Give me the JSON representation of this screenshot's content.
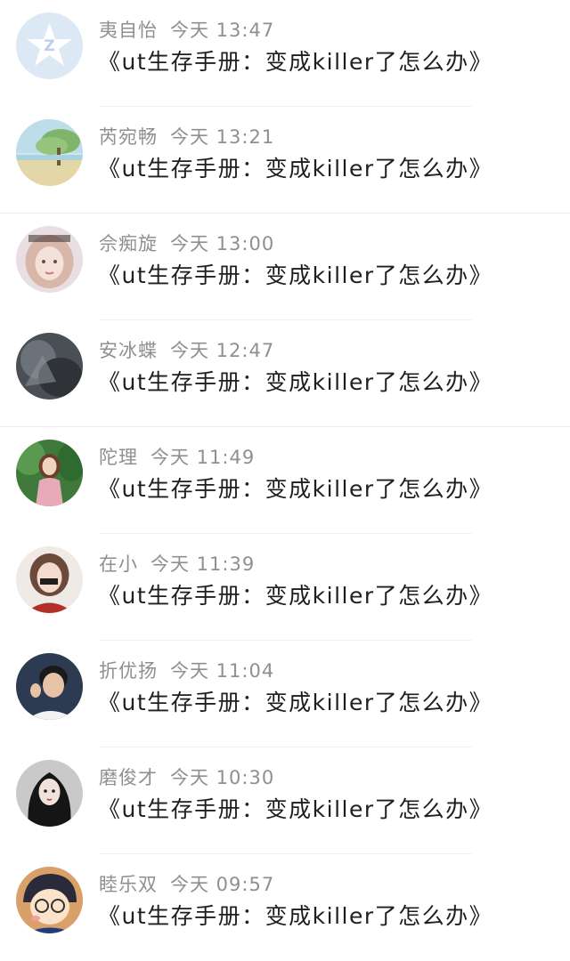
{
  "messages": [
    {
      "name": "夷自怡",
      "time": "今天 13:47",
      "text": "《ut生存手册：变成killer了怎么办》",
      "avatar_icon": "default-blue-avatar"
    },
    {
      "name": "芮宛畅",
      "time": "今天 13:21",
      "text": "《ut生存手册：变成killer了怎么办》",
      "avatar_icon": "landscape-tree-avatar"
    },
    {
      "name": "佘痴旋",
      "time": "今天 13:00",
      "text": "《ut生存手册：变成killer了怎么办》",
      "avatar_icon": "girl-portrait-avatar"
    },
    {
      "name": "安冰蝶",
      "time": "今天 12:47",
      "text": "《ut生存手册：变成killer了怎么办》",
      "avatar_icon": "dark-photo-avatar"
    },
    {
      "name": "陀理",
      "time": "今天 11:49",
      "text": "《ut生存手册：变成killer了怎么办》",
      "avatar_icon": "girl-outdoor-avatar"
    },
    {
      "name": "在小",
      "time": "今天 11:39",
      "text": "《ut生存手册：变成killer了怎么办》",
      "avatar_icon": "girl-red-avatar"
    },
    {
      "name": "折优扬",
      "time": "今天 11:04",
      "text": "《ut生存手册：变成killer了怎么办》",
      "avatar_icon": "boy-portrait-avatar"
    },
    {
      "name": "磨俊才",
      "time": "今天 10:30",
      "text": "《ut生存手册：变成killer了怎么办》",
      "avatar_icon": "dark-hair-girl-avatar"
    },
    {
      "name": "睦乐双",
      "time": "今天 09:57",
      "text": "《ut生存手册：变成killer了怎么办》",
      "avatar_icon": "cartoon-boy-glasses-avatar"
    }
  ]
}
